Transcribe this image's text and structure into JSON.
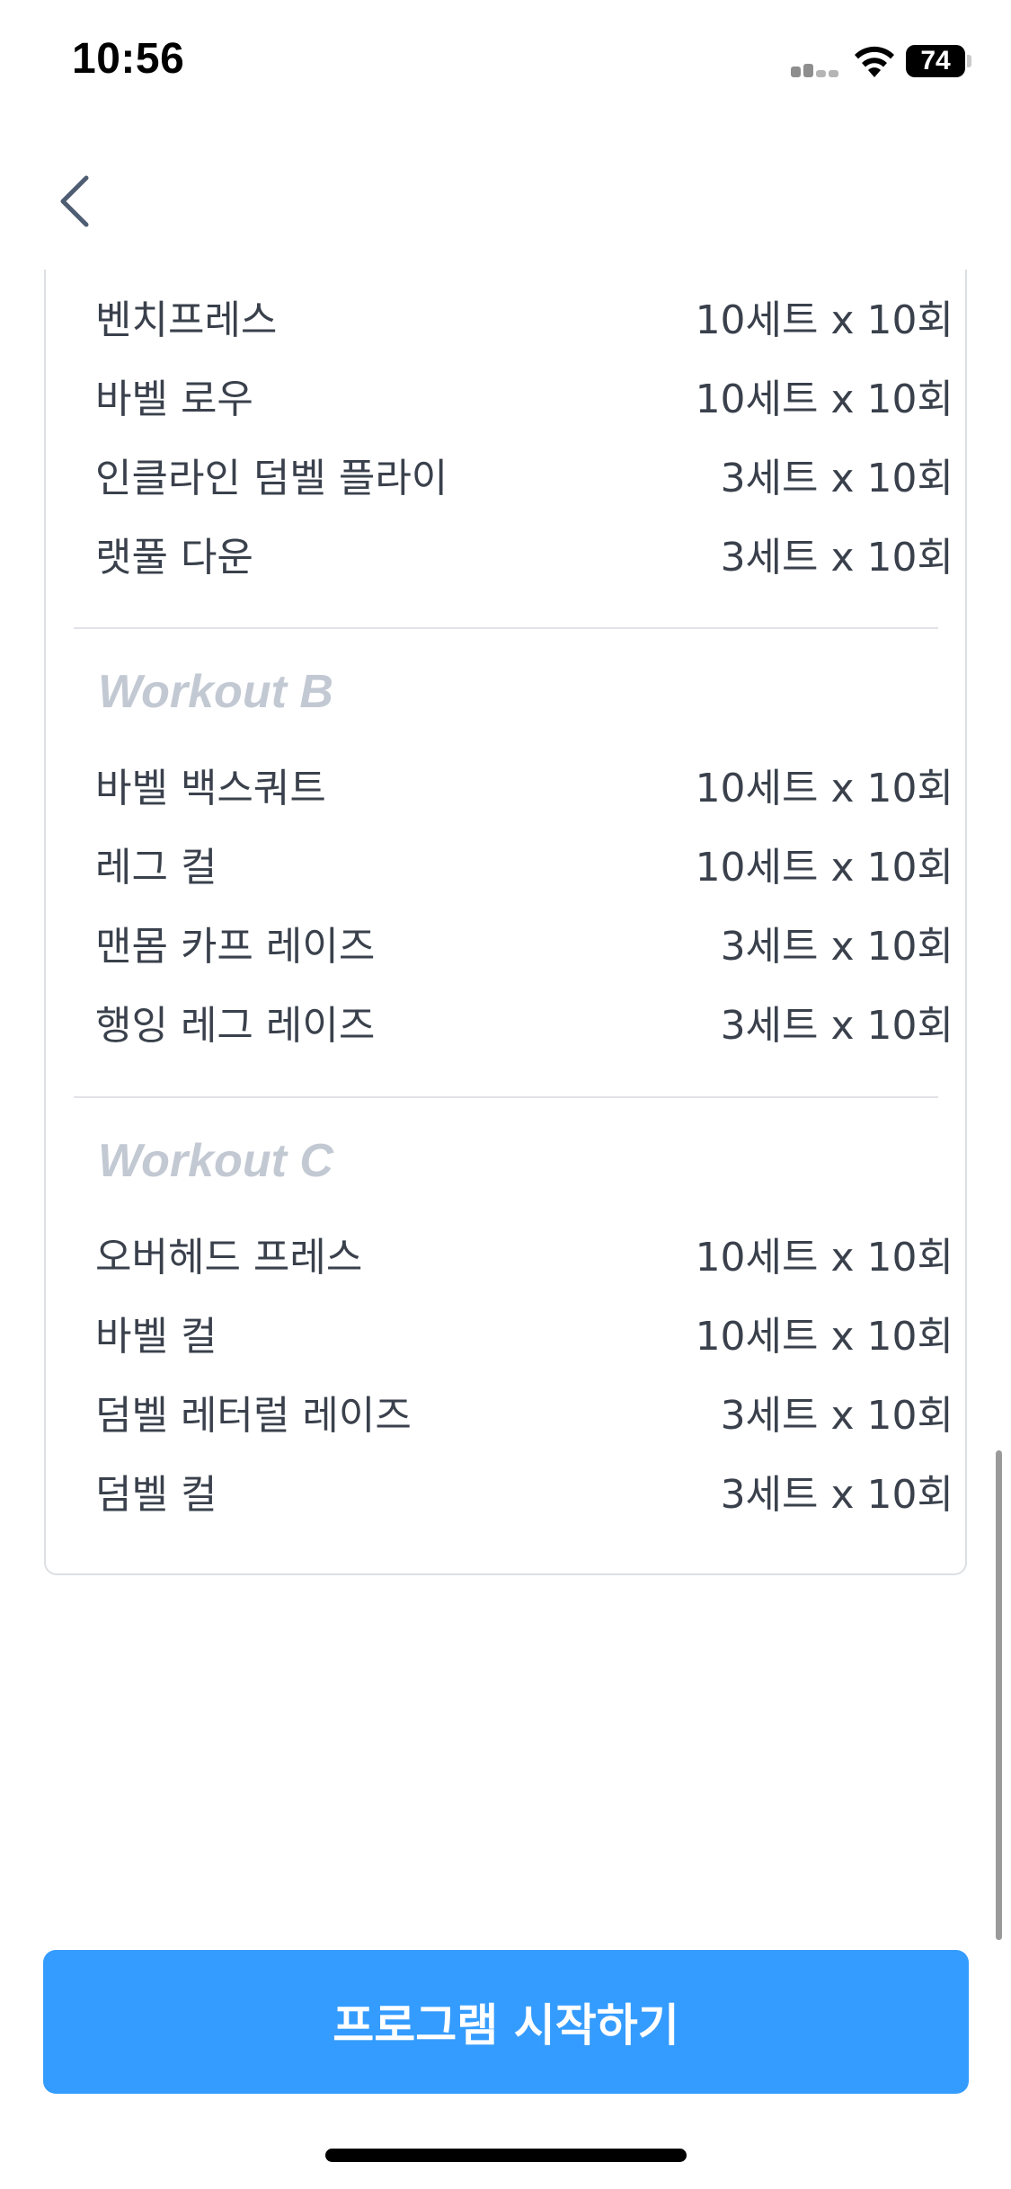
{
  "status_bar": {
    "time": "10:56",
    "battery": "74",
    "icons": [
      "signal-icon",
      "wifi-icon",
      "battery-icon"
    ]
  },
  "nav": {
    "back_icon": "chevron-left-icon"
  },
  "workouts": [
    {
      "title": "",
      "exercises": [
        {
          "name": "벤치프레스",
          "sets": "10세트 x 10회"
        },
        {
          "name": "바벨 로우",
          "sets": "10세트 x 10회"
        },
        {
          "name": "인클라인 덤벨 플라이",
          "sets": "3세트 x 10회"
        },
        {
          "name": "랫풀 다운",
          "sets": "3세트 x 10회"
        }
      ]
    },
    {
      "title": "Workout B",
      "exercises": [
        {
          "name": "바벨 백스쿼트",
          "sets": "10세트 x 10회"
        },
        {
          "name": "레그 컬",
          "sets": "10세트 x 10회"
        },
        {
          "name": "맨몸 카프 레이즈",
          "sets": "3세트 x 10회"
        },
        {
          "name": "행잉 레그 레이즈",
          "sets": "3세트 x 10회"
        }
      ]
    },
    {
      "title": "Workout C",
      "exercises": [
        {
          "name": "오버헤드 프레스",
          "sets": "10세트 x 10회"
        },
        {
          "name": "바벨 컬",
          "sets": "10세트 x 10회"
        },
        {
          "name": "덤벨 레터럴 레이즈",
          "sets": "3세트 x 10회"
        },
        {
          "name": "덤벨 컬",
          "sets": "3세트 x 10회"
        }
      ]
    }
  ],
  "start_button": {
    "label": "프로그램 시작하기"
  },
  "colors": {
    "accent": "#359cff",
    "workout_title": "#c3c9d3",
    "text": "#3a414c",
    "divider": "#e1e3e7"
  }
}
